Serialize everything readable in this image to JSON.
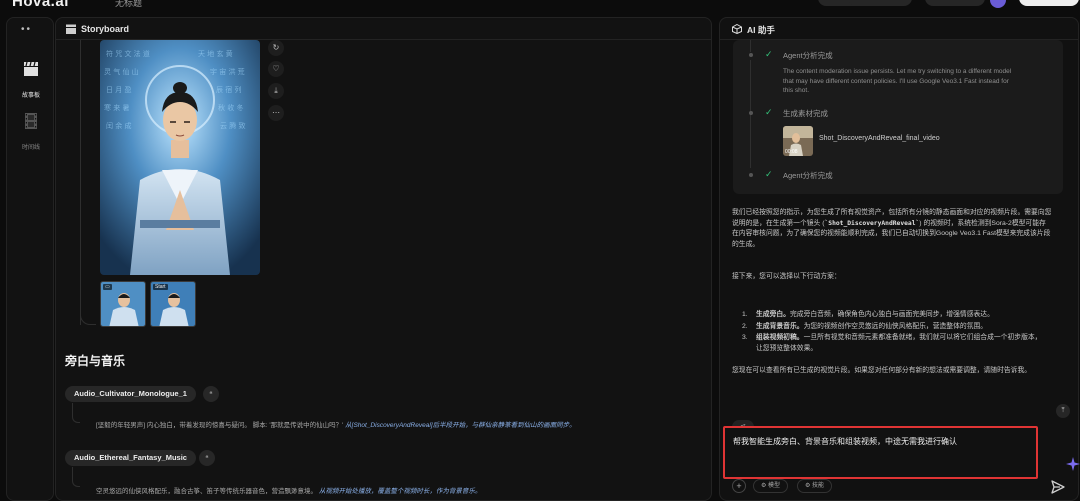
{
  "app": {
    "logo": "Hova.ai",
    "project_title": "无标题"
  },
  "rail": {
    "items": [
      {
        "label": "故事板",
        "icon": "clapperboard-icon",
        "active": true
      },
      {
        "label": "时间线",
        "icon": "film-strip-icon",
        "active": false
      }
    ]
  },
  "storyboard": {
    "title": "Storyboard",
    "side_buttons": [
      "refresh-icon",
      "heart-icon",
      "download-icon",
      "more-icon"
    ],
    "thumbs": [
      {
        "tag": ""
      },
      {
        "tag": "Start"
      }
    ],
    "section_title": "旁白与音乐",
    "audio": [
      {
        "name": "Audio_Cultivator_Monologue_1",
        "text": "[坚毅的年轻男声] 内心独白，带着发现的惊喜与疑问。 脚本: '那就是传说中的仙山吗？'",
        "note": "从[Shot_DiscoveryAndReveal]后半段开始，与群仙亲静篆看到仙山的画面同步。"
      },
      {
        "name": "Audio_Ethereal_Fantasy_Music",
        "text": "空灵悠远的仙侠风格配乐，融合古筝、笛子等传统乐器音色，营造飘渺意境。",
        "note": "从视频开始处播放，覆盖整个视频时长，作为背景音乐。"
      }
    ]
  },
  "assistant": {
    "title": "AI 助手",
    "steps": [
      {
        "title": "Agent分析完成",
        "detail": "The content moderation issue persists. Let me try switching to a different model that may have different content policies. I'll use Google Veo3.1 Fast instead for this shot."
      },
      {
        "title": "生成素材完成",
        "video": {
          "duration": "00:08",
          "name": "Shot_DiscoveryAndReveal_final_video"
        }
      },
      {
        "title": "Agent分析完成"
      }
    ],
    "message_p1_a": "我们已经按照您的指示，为您生成了所有视觉资产，包括所有分镜的静态画面和对应的视频片段。需要向您说明的是，在生成第一个镜头 (",
    "message_p1_code": "`Shot_DiscoveryAndReveal`",
    "message_p1_b": ") 的视频时，系统检测到Sora-2模型可能存在内容审核问题，为了确保您的视频能顺利完成，我们已自动切换到Google Veo3.1 Fast模型来完成该片段的生成。",
    "message_p2": "接下来，您可以选择以下行动方案：",
    "options": [
      {
        "num": "1.",
        "title": "生成旁白。",
        "text": "完成旁白音频，确保角色内心独白与画面完美同步，增强情感表达。"
      },
      {
        "num": "2.",
        "title": "生成背景音乐。",
        "text": "为您的视频创作空灵悠远的仙侠风格配乐，营造整体的氛围。"
      },
      {
        "num": "3.",
        "title": "组装视频初稿。",
        "text": "一旦所有视觉和音频元素都准备就绪，我们就可以将它们组合成一个初步版本，让您预览整体效果。"
      }
    ],
    "message_p3": "您现在可以查看所有已生成的视觉片段。如果您对任何部分有新的想法或需要调整，请随时告诉我。",
    "input_text": "帮我智能生成旁白、背景音乐和组装视频，中途无需我进行确认",
    "tools": [
      "模型",
      "技能"
    ]
  },
  "colors": {
    "accent_check": "#34c27a",
    "highlight_border": "#e03434",
    "note_blue": "#8ab0e8"
  }
}
